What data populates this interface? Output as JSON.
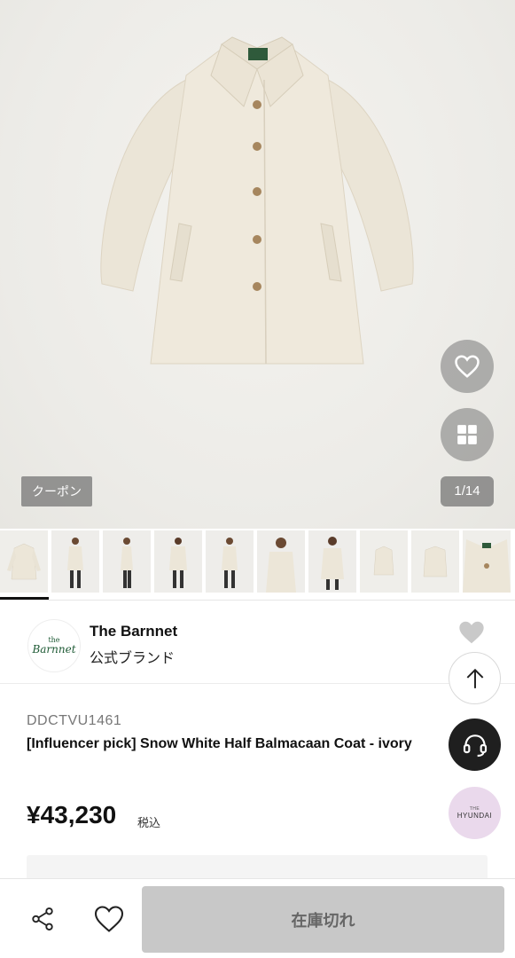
{
  "hero": {
    "coupon_label": "クーポン",
    "image_counter": "1/14",
    "favorite_icon": "heart-icon",
    "gallery_icon": "grid-icon"
  },
  "thumbnails": {
    "count": 10,
    "active_index": 0
  },
  "brand": {
    "name": "The Barnnet",
    "subtitle": "公式ブランド",
    "logo_text_top": "the",
    "logo_text_main": "Barnnet"
  },
  "product": {
    "sku": "DDCTVU1461",
    "title": "[Influencer pick] Snow White Half Balmacaan Coat - ivory",
    "price": "¥43,230",
    "tax_label": "税込"
  },
  "floating": {
    "scroll_top_icon": "arrow-up-icon",
    "support_icon": "headset-icon",
    "hyundai_small": "THE",
    "hyundai_label": "HYUNDAI"
  },
  "bottom_bar": {
    "share_icon": "share-icon",
    "wishlist_icon": "heart-outline-icon",
    "cta_label": "在庫切れ"
  },
  "colors": {
    "coat": "#ece6d8",
    "hero_bg": "#efefeb",
    "soldout_bg": "#c8c8c8",
    "hyundai_bg": "#ead9ec"
  }
}
